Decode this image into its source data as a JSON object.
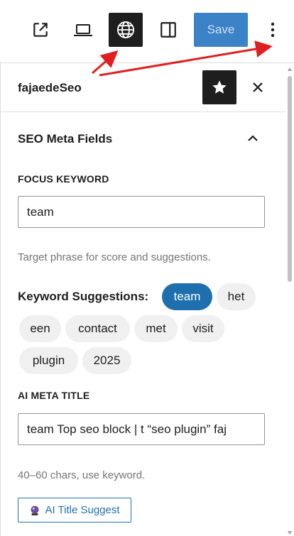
{
  "toolbar": {
    "icons": [
      "external-link-icon",
      "laptop-preview-icon",
      "globe-icon",
      "sidebar-toggle-icon",
      "kebab-menu-icon"
    ],
    "save_label": "Save",
    "save_color": "#3b83c6"
  },
  "panel": {
    "title": "fajaedeSeo",
    "icons": [
      "star-icon",
      "close-icon"
    ]
  },
  "section": {
    "title": "SEO Meta Fields",
    "expanded": true
  },
  "focus_keyword": {
    "label": "FOCUS KEYWORD",
    "value": "team",
    "help": "Target phrase for score and suggestions."
  },
  "suggestions": {
    "label": "Keyword Suggestions:",
    "chips": [
      "team",
      "het",
      "een",
      "contact",
      "met",
      "visit",
      "plugin",
      "2025"
    ],
    "active": "team",
    "active_color": "#1e6fae"
  },
  "ai_title": {
    "label": "AI META TITLE",
    "value": "team Top seo block | t “seo plugin” faj",
    "help": "40–60 chars, use keyword.",
    "button_label": "AI Title Suggest",
    "button_icon": "crystal-ball-icon",
    "accent": "#2271b1"
  },
  "annotation": {
    "arrow_color": "#e02020",
    "arrows": [
      "arrow-to-globe",
      "arrow-to-menu"
    ]
  }
}
